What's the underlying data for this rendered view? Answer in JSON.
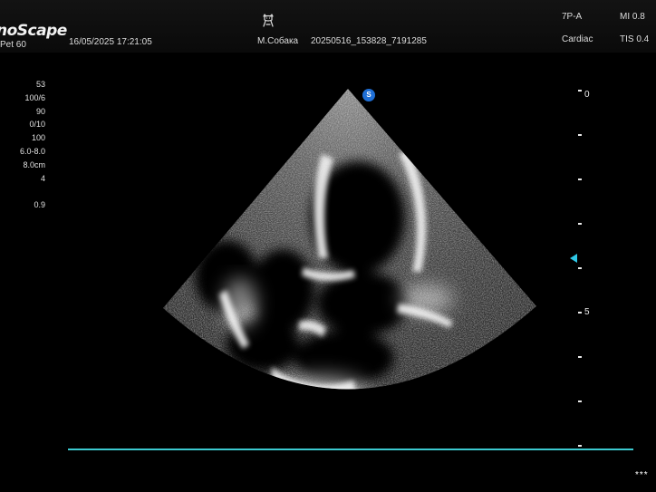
{
  "header": {
    "brand": "noScape",
    "preset": "Pet 60",
    "datetime": "16/05/2025 17:21:05",
    "patient_icon": "dog-icon",
    "patient_name": "М.Собака",
    "exam_id": "20250516_153828_7191285",
    "probe": "7P-A",
    "mode": "Cardiac",
    "mi": "MI 0.8",
    "tis": "TIS 0.4"
  },
  "params": [
    "53",
    "100/6",
    "90",
    "0/10",
    "100",
    "6.0-8.0",
    "8.0cm",
    "4",
    "",
    "0.9"
  ],
  "image": {
    "orientation_marker": "S",
    "orientation_color": "#1f6fd6"
  },
  "depth_scale": {
    "labels": [
      "0",
      "5"
    ],
    "focus_color": "#2ec7e6"
  },
  "timeline": {
    "color": "#3cc9cf"
  },
  "footer": {
    "stars": "***"
  }
}
